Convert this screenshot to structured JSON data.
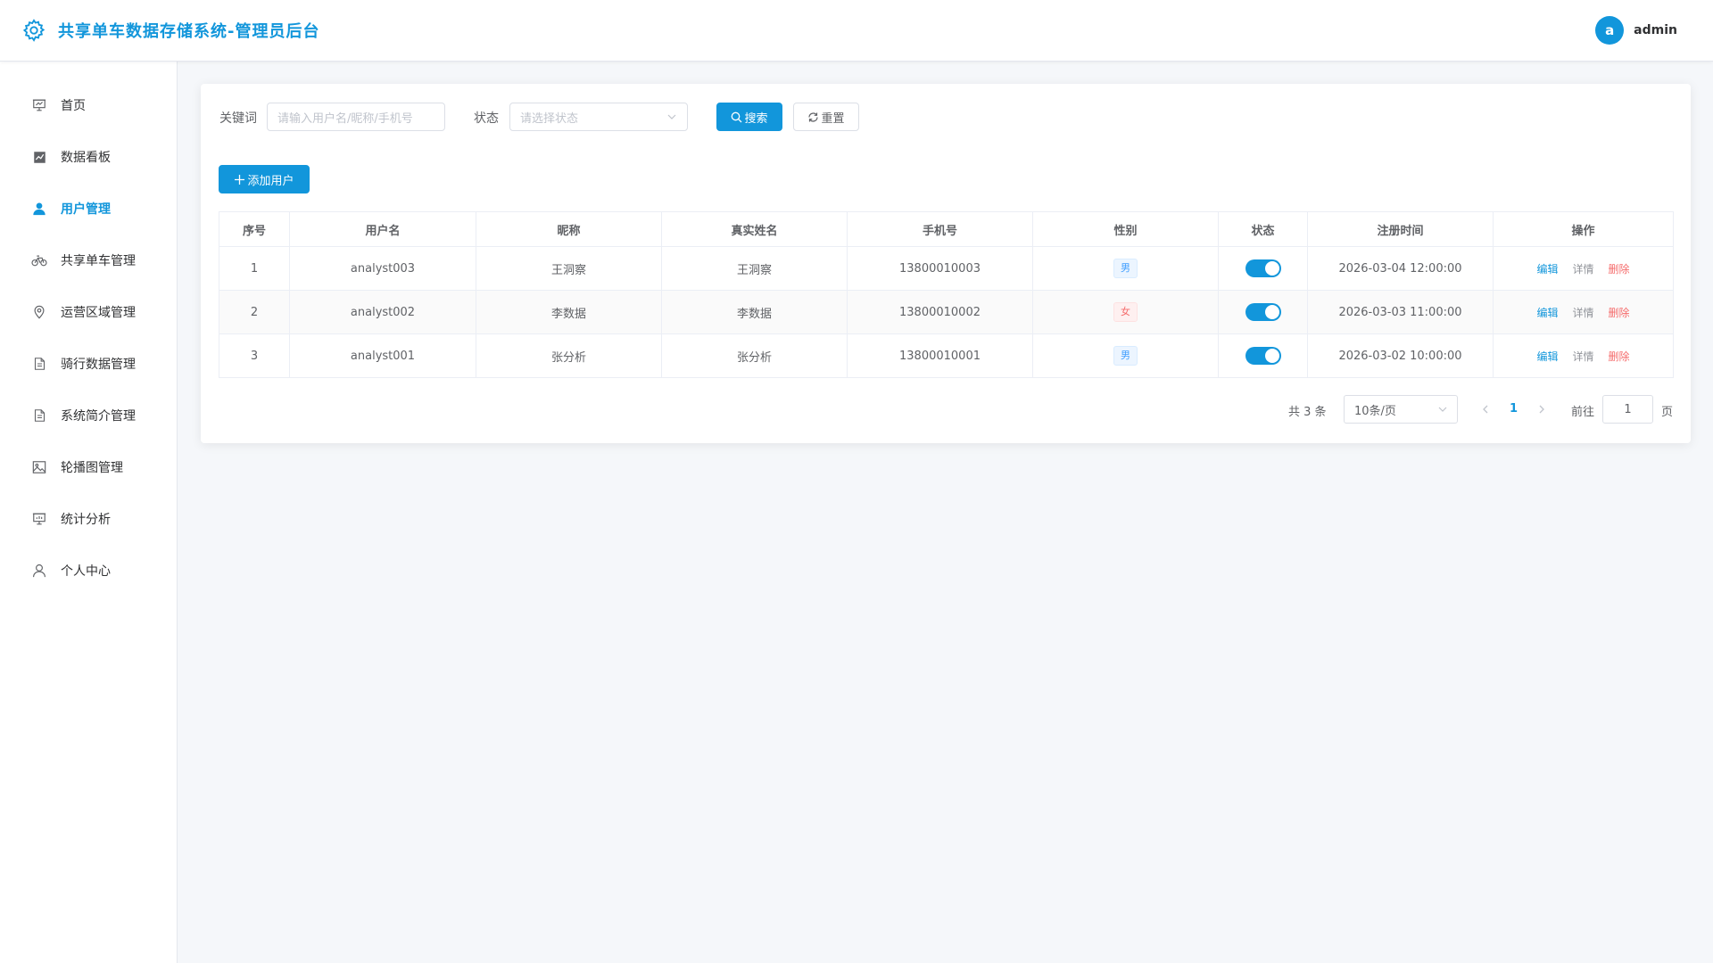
{
  "header": {
    "title": "共享单车数据存储系统-管理员后台",
    "avatar_letter": "a",
    "username": "admin"
  },
  "sidebar": {
    "items": [
      {
        "label": "首页",
        "icon": "home-icon",
        "active": false
      },
      {
        "label": "数据看板",
        "icon": "chart-icon",
        "active": false
      },
      {
        "label": "用户管理",
        "icon": "user-icon",
        "active": true
      },
      {
        "label": "共享单车管理",
        "icon": "bicycle-icon",
        "active": false
      },
      {
        "label": "运营区域管理",
        "icon": "location-icon",
        "active": false
      },
      {
        "label": "骑行数据管理",
        "icon": "document-icon",
        "active": false
      },
      {
        "label": "系统简介管理",
        "icon": "document-icon",
        "active": false
      },
      {
        "label": "轮播图管理",
        "icon": "picture-icon",
        "active": false
      },
      {
        "label": "统计分析",
        "icon": "presentation-icon",
        "active": false
      },
      {
        "label": "个人中心",
        "icon": "person-icon",
        "active": false
      }
    ]
  },
  "filters": {
    "keyword_label": "关键词",
    "keyword_placeholder": "请输入用户名/昵称/手机号",
    "status_label": "状态",
    "status_placeholder": "请选择状态",
    "search_label": "搜索",
    "reset_label": "重置"
  },
  "toolbar": {
    "add_label": "添加用户"
  },
  "table": {
    "columns": [
      "序号",
      "用户名",
      "昵称",
      "真实姓名",
      "手机号",
      "性别",
      "状态",
      "注册时间",
      "操作"
    ],
    "rows": [
      {
        "index": "1",
        "username": "analyst003",
        "nickname": "王洞察",
        "realname": "王洞察",
        "phone": "13800010003",
        "gender": "男",
        "enabled": true,
        "registered": "2026-03-04 12:00:00"
      },
      {
        "index": "2",
        "username": "analyst002",
        "nickname": "李数据",
        "realname": "李数据",
        "phone": "13800010002",
        "gender": "女",
        "enabled": true,
        "registered": "2026-03-03 11:00:00"
      },
      {
        "index": "3",
        "username": "analyst001",
        "nickname": "张分析",
        "realname": "张分析",
        "phone": "13800010001",
        "gender": "男",
        "enabled": true,
        "registered": "2026-03-02 10:00:00"
      }
    ],
    "actions": {
      "edit": "编辑",
      "detail": "详情",
      "delete": "删除"
    }
  },
  "pagination": {
    "total_text": "共 3 条",
    "page_size": "10条/页",
    "current_page": "1",
    "goto_label": "前往",
    "goto_value": "1",
    "page_suffix": "页"
  },
  "colors": {
    "brand": "#1296db",
    "danger": "#f56c6c",
    "male_tag": "#409eff"
  }
}
